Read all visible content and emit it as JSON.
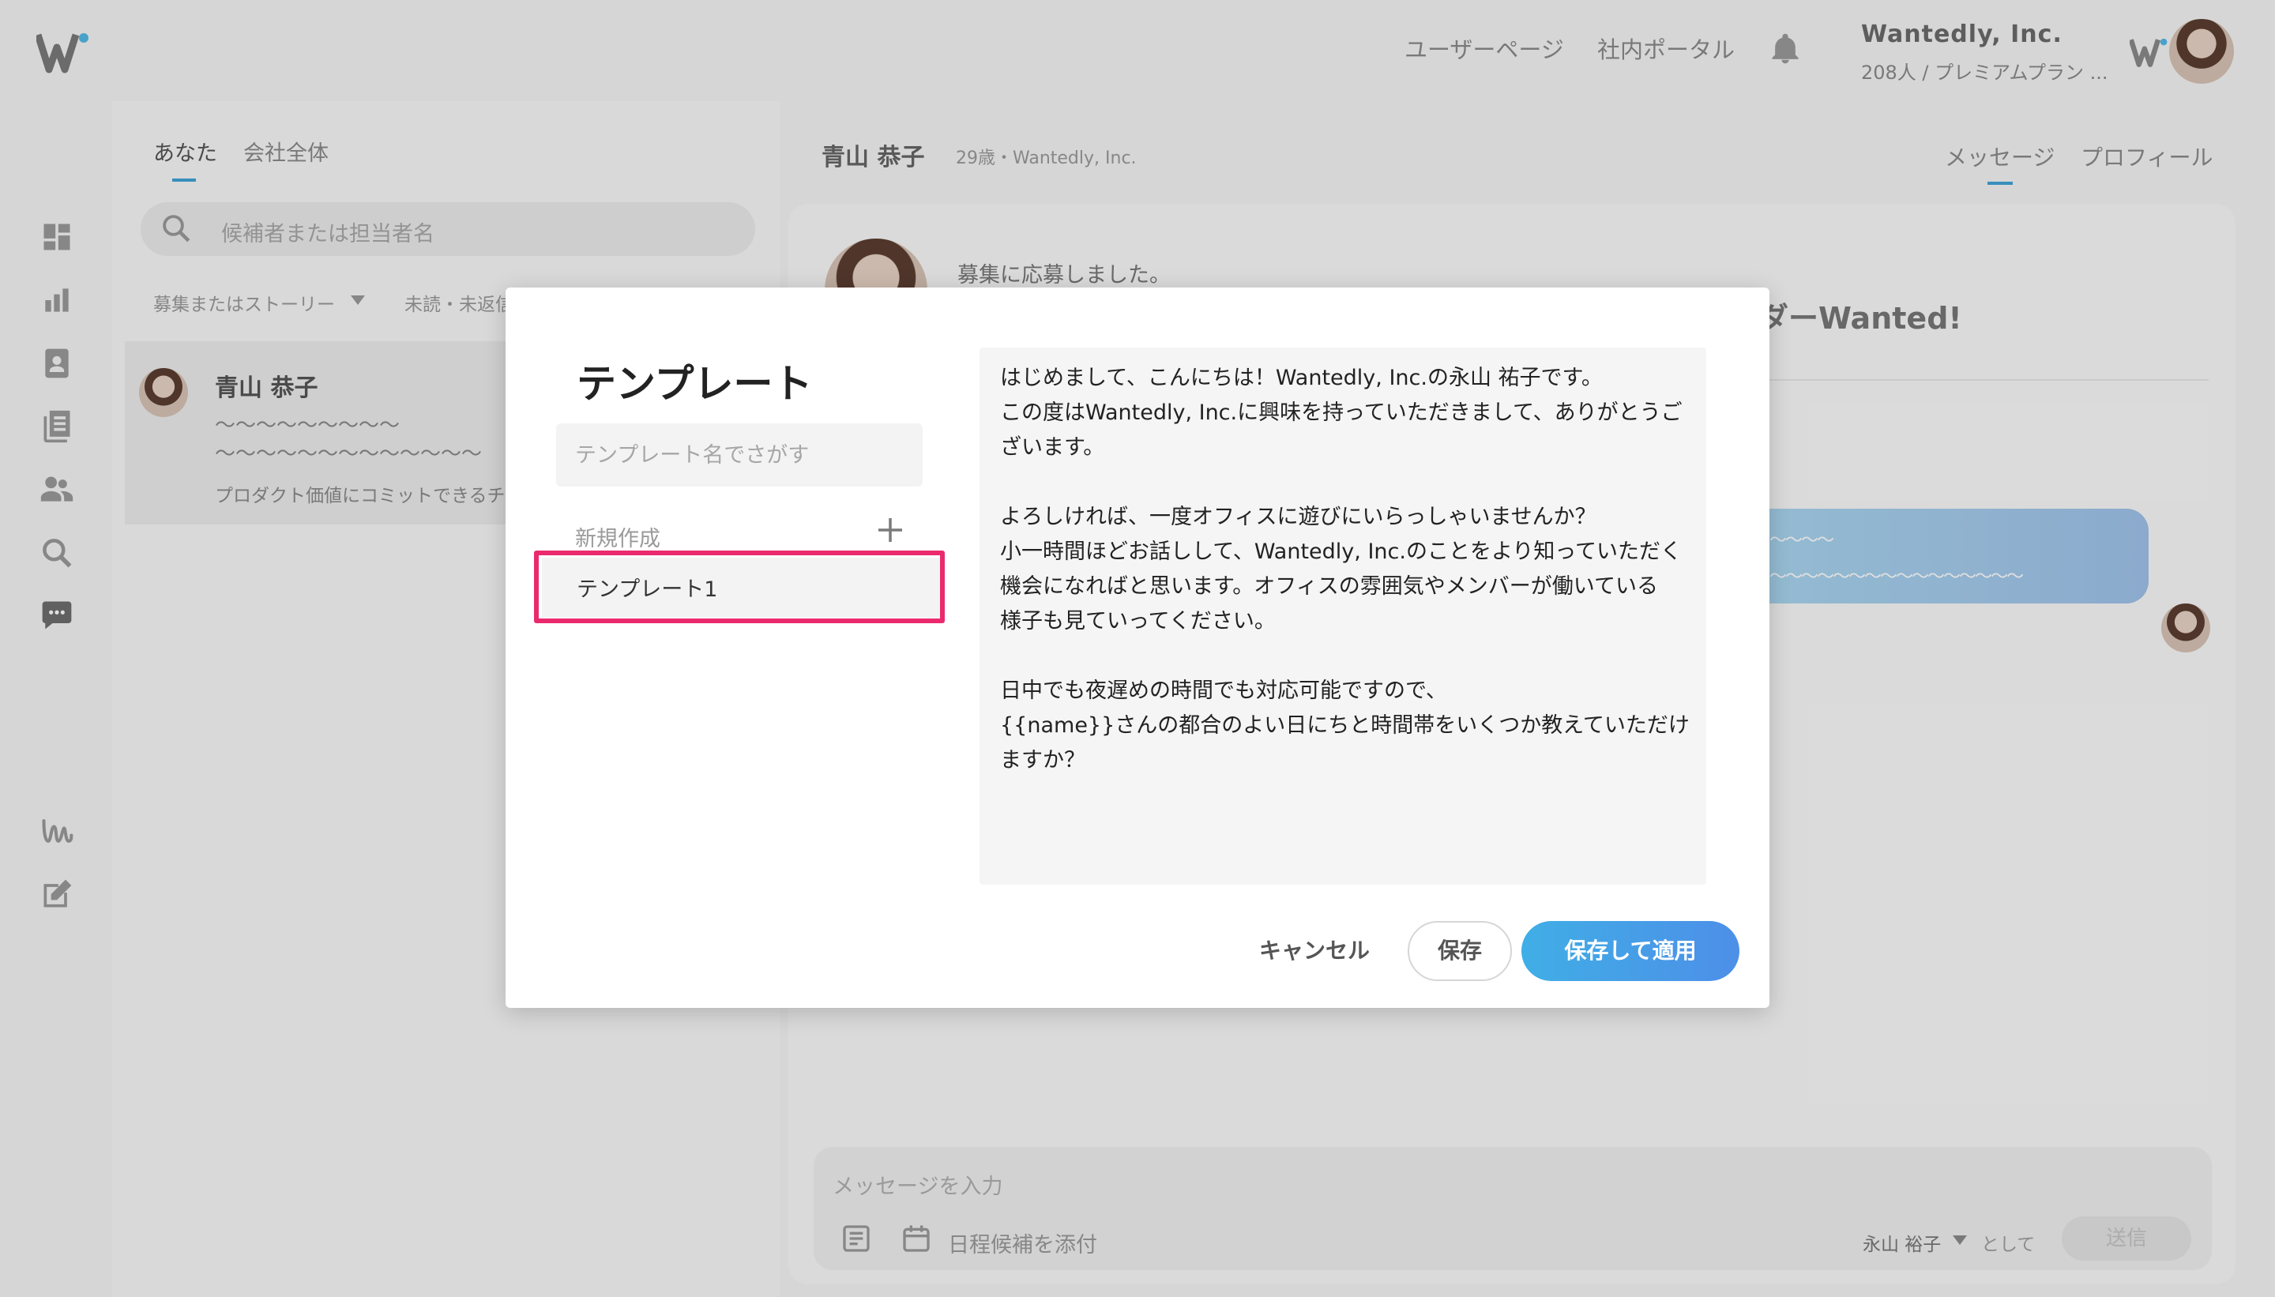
{
  "header": {
    "user_page_link": "ユーザーページ",
    "portal_link": "社内ポータル",
    "company_name": "Wantedly, Inc.",
    "company_sub": "208人 / プレミアムプラン ..."
  },
  "sidebar": {
    "icons": [
      "dashboard-icon",
      "analytics-icon",
      "recruit-icon",
      "articles-icon",
      "members-icon",
      "search-icon",
      "chat-icon",
      "wantedly-icon",
      "edit-icon"
    ]
  },
  "list": {
    "tabs": [
      "あなた",
      "会社全体"
    ],
    "search_placeholder": "候補者または担当者名",
    "filters": [
      "募集またはストーリー",
      "未読・未返信"
    ],
    "candidate": {
      "name": "青山 恭子",
      "line1": "〜〜〜〜〜〜〜〜〜",
      "line2": "〜〜〜〜〜〜〜〜〜〜〜〜〜",
      "line3": "プロダクト価値にコミットできるチ"
    }
  },
  "conversation": {
    "name": "青山 恭子",
    "sub": "29歳・Wantedly, Inc.",
    "tabs": [
      "メッセージ",
      "プロフィール"
    ],
    "applied": "募集に応募しました。",
    "title_fragment": "ダーWanted!",
    "bubble_line1": "〜〜〜〜",
    "bubble_line2": "〜〜〜〜〜〜〜〜〜〜〜〜〜〜〜〜",
    "input_placeholder": "メッセージを入力",
    "attach_label": "日程候補を添付",
    "sender": "永山 裕子",
    "as_label": "として",
    "send_label": "送信"
  },
  "modal": {
    "title": "テンプレート",
    "search_placeholder": "テンプレート名でさがす",
    "new_label": "新規作成",
    "plus": "+",
    "template_item": "テンプレート1",
    "body_lines": [
      "はじめまして、こんにちは！Wantedly, Inc.の永山 祐子です。",
      "この度はWantedly, Inc.に興味を持っていただきまして、ありがとうご",
      "ざいます。",
      "",
      "よろしければ、一度オフィスに遊びにいらっしゃいませんか？",
      "小一時間ほどお話しして、Wantedly, Inc.のことをより知っていただく",
      "機会になればと思います。オフィスの雰囲気やメンバーが働いている",
      "様子も見ていってください。",
      "",
      "日中でも夜遅めの時間でも対応可能ですので、",
      "{{name}}さんの都合のよい日にちと時間帯をいくつか教えていただけ",
      "ますか？"
    ],
    "cancel_label": "キャンセル",
    "save_label": "保存",
    "apply_label": "保存して適用"
  },
  "colors": {
    "accent": "#3fa3d7",
    "highlight": "#ea2a6c",
    "apply_gradient_start": "#40aee6",
    "apply_gradient_end": "#4d8fe8"
  }
}
